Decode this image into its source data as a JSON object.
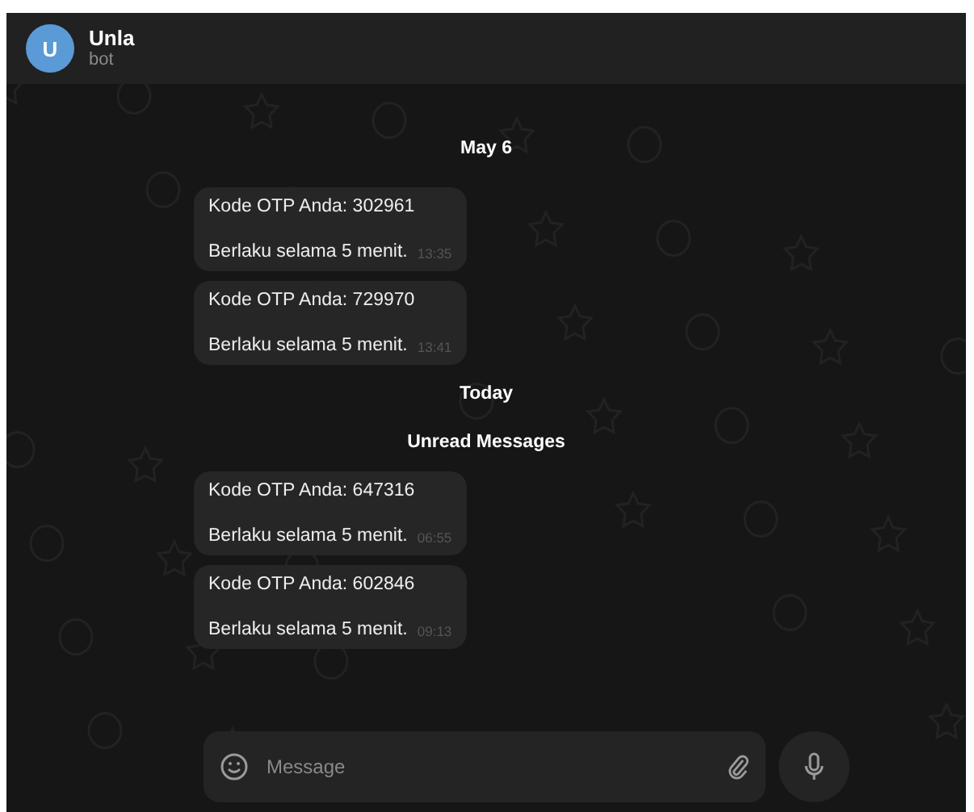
{
  "header": {
    "avatar_letter": "U",
    "name": "Unla",
    "subtitle": "bot"
  },
  "timeline": [
    {
      "kind": "date",
      "text": "May 6"
    },
    {
      "kind": "message",
      "lines": [
        "Kode OTP Anda: 302961",
        "Berlaku selama 5 menit."
      ],
      "time": "13:35"
    },
    {
      "kind": "message",
      "lines": [
        "Kode OTP Anda: 729970",
        "Berlaku selama 5 menit."
      ],
      "time": "13:41"
    },
    {
      "kind": "date",
      "text": "Today"
    },
    {
      "kind": "date",
      "text": "Unread Messages"
    },
    {
      "kind": "message",
      "lines": [
        "Kode OTP Anda: 647316",
        "Berlaku selama 5 menit."
      ],
      "time": "06:55"
    },
    {
      "kind": "message",
      "lines": [
        "Kode OTP Anda: 602846",
        "Berlaku selama 5 menit."
      ],
      "time": "09:13"
    }
  ],
  "composer": {
    "placeholder": "Message"
  }
}
